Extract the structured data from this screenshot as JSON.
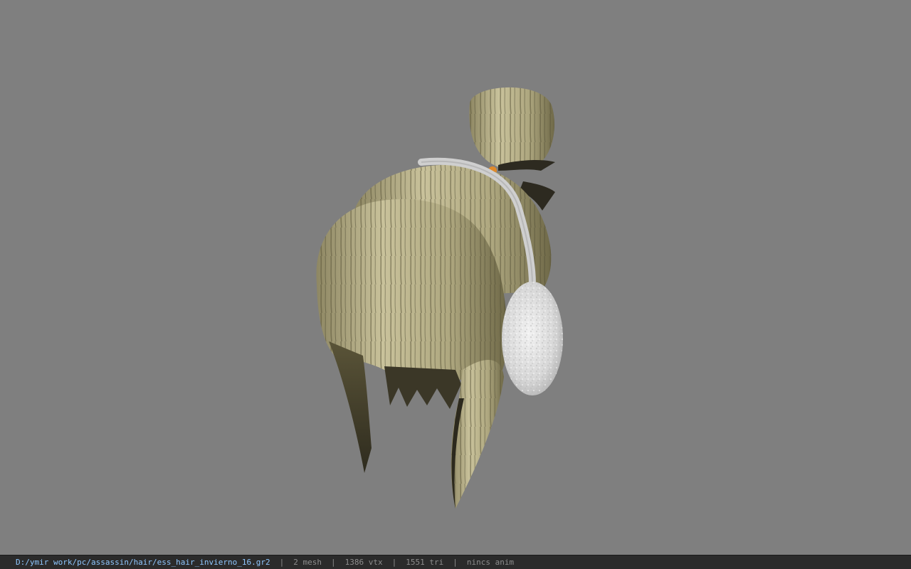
{
  "viewer": {
    "background_color": "#7f7f7f",
    "model_icon": "hair-model-render",
    "colors": {
      "hair_light": "#b7b089",
      "hair_dark": "#4a4530",
      "earmuff": "#dcdcdc",
      "band": "#e08a2a"
    }
  },
  "status": {
    "path": "D:/ymir work/pc/assassin/hair/ess_hair_invierno_16.gr2",
    "separator": "|",
    "mesh": "2 mesh",
    "vertices": "1386 vtx",
    "triangles": "1551 tri",
    "animation": "nincs anim"
  }
}
